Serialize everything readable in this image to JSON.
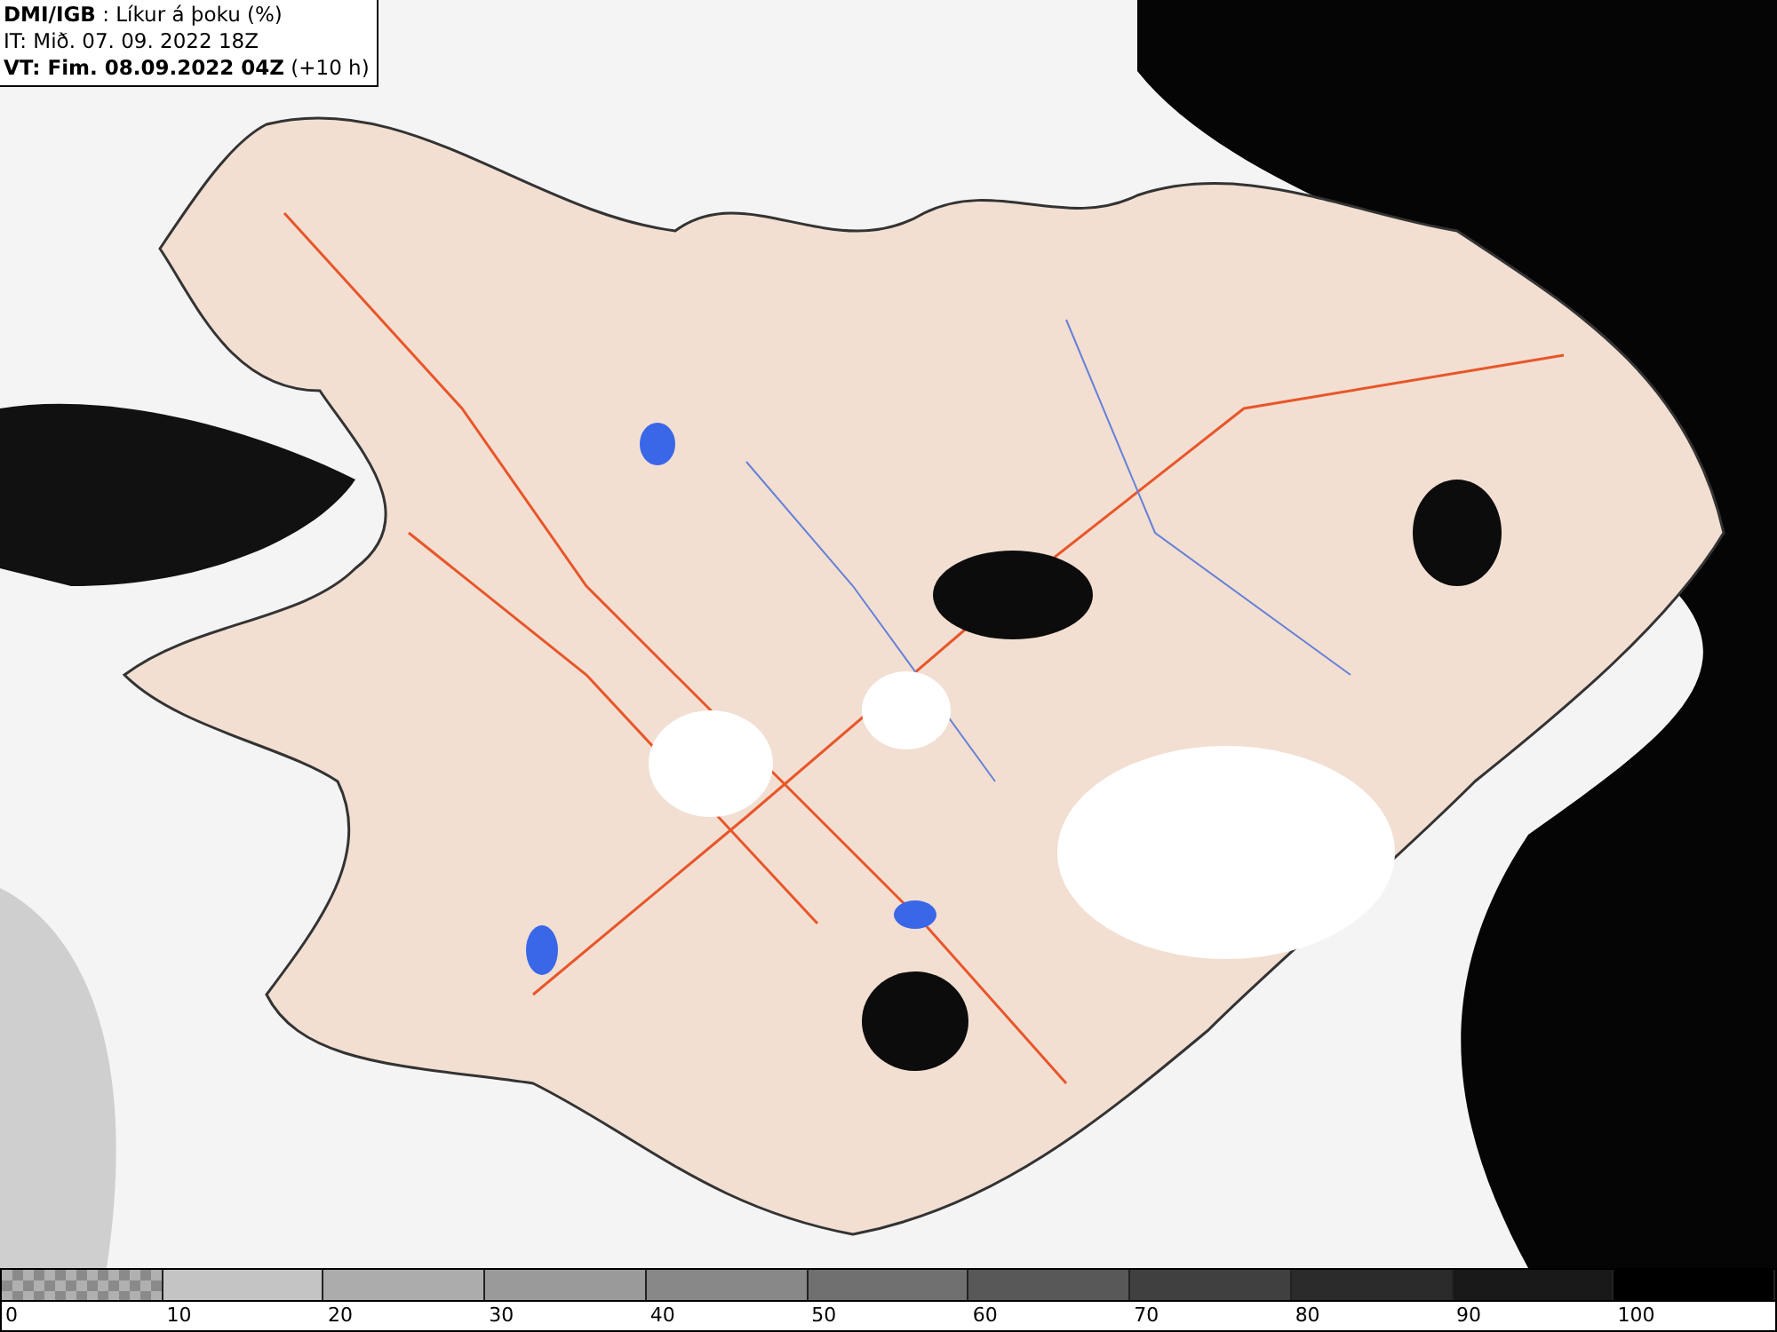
{
  "header": {
    "lines": [
      "**DMI/IGB** : Líkur á þoku (%)",
      "IT: Mið. 07. 09. 2022 18Z",
      "**VT: Fim. 08.09.2022 04Z** (+10 h)"
    ]
  },
  "legend": {
    "segments": [
      {
        "kind": "checker",
        "color": "#8a8a8a",
        "label": "0"
      },
      {
        "kind": "solid",
        "color": "#c4c4c4",
        "label": "10"
      },
      {
        "kind": "solid",
        "color": "#acacac",
        "label": "20"
      },
      {
        "kind": "solid",
        "color": "#9a9a9a",
        "label": "30"
      },
      {
        "kind": "solid",
        "color": "#888888",
        "label": "40"
      },
      {
        "kind": "solid",
        "color": "#707070",
        "label": "50"
      },
      {
        "kind": "solid",
        "color": "#585858",
        "label": "60"
      },
      {
        "kind": "solid",
        "color": "#404040",
        "label": "70"
      },
      {
        "kind": "solid",
        "color": "#2a2a2a",
        "label": "80"
      },
      {
        "kind": "solid",
        "color": "#181818",
        "label": "90"
      },
      {
        "kind": "solid",
        "color": "#000000",
        "label": "100"
      }
    ]
  }
}
